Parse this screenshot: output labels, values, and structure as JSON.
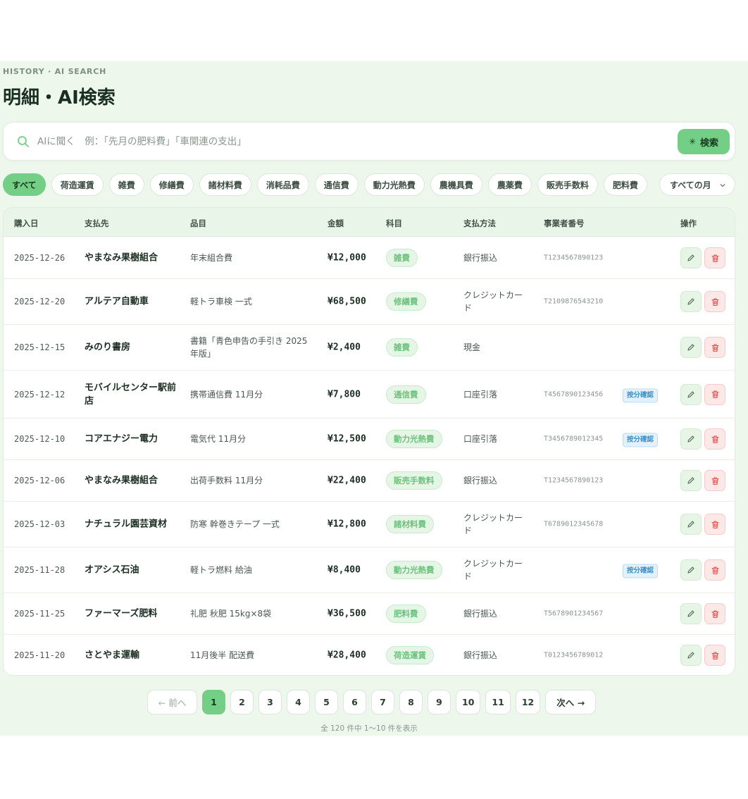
{
  "header": {
    "eyebrow": "HISTORY · AI SEARCH",
    "title": "明細・AI検索"
  },
  "search": {
    "placeholder": "AIに聞く　例：「先月の肥料費」「車関連の支出」",
    "button_label": "検索",
    "button_icon": "sparkle-icon"
  },
  "filters": {
    "chips": [
      "すべて",
      "荷造運賃",
      "雑費",
      "修繕費",
      "諸材料費",
      "消耗品費",
      "通信費",
      "動力光熱費",
      "農機具費",
      "農薬費",
      "販売手数料",
      "肥料費"
    ],
    "active_index": 0,
    "month_select": "すべての月"
  },
  "table": {
    "headers": {
      "date": "購入日",
      "payee": "支払先",
      "item": "品目",
      "amount": "金額",
      "category": "科目",
      "method": "支払方法",
      "registration": "事業者番号",
      "actions": "操作"
    },
    "rows": [
      {
        "date": "2025-12-26",
        "payee": "やまなみ果樹組合",
        "item": "年末組合費",
        "amount": "¥12,000",
        "category": "雑費",
        "method": "銀行振込",
        "registration": "T1234567890123",
        "flag": ""
      },
      {
        "date": "2025-12-20",
        "payee": "アルテア自動車",
        "item": "軽トラ車検 一式",
        "amount": "¥68,500",
        "category": "修繕費",
        "method": "クレジットカード",
        "registration": "T2109876543210",
        "flag": ""
      },
      {
        "date": "2025-12-15",
        "payee": "みのり書房",
        "item": "書籍「青色申告の手引き 2025年版」",
        "amount": "¥2,400",
        "category": "雑費",
        "method": "現金",
        "registration": "",
        "flag": ""
      },
      {
        "date": "2025-12-12",
        "payee": "モバイルセンター駅前店",
        "item": "携帯通信費 11月分",
        "amount": "¥7,800",
        "category": "通信費",
        "method": "口座引落",
        "registration": "T4567890123456",
        "flag": "按分確認"
      },
      {
        "date": "2025-12-10",
        "payee": "コアエナジー電力",
        "item": "電気代 11月分",
        "amount": "¥12,500",
        "category": "動力光熱費",
        "method": "口座引落",
        "registration": "T3456789012345",
        "flag": "按分確認"
      },
      {
        "date": "2025-12-06",
        "payee": "やまなみ果樹組合",
        "item": "出荷手数料 11月分",
        "amount": "¥22,400",
        "category": "販売手数料",
        "method": "銀行振込",
        "registration": "T1234567890123",
        "flag": ""
      },
      {
        "date": "2025-12-03",
        "payee": "ナチュラル園芸資材",
        "item": "防寒 幹巻きテープ 一式",
        "amount": "¥12,800",
        "category": "諸材料費",
        "method": "クレジットカード",
        "registration": "T6789012345678",
        "flag": ""
      },
      {
        "date": "2025-11-28",
        "payee": "オアシス石油",
        "item": "軽トラ燃料 給油",
        "amount": "¥8,400",
        "category": "動力光熱費",
        "method": "クレジットカード",
        "registration": "",
        "flag": "按分確認"
      },
      {
        "date": "2025-11-25",
        "payee": "ファーマーズ肥料",
        "item": "礼肥 秋肥 15kg×8袋",
        "amount": "¥36,500",
        "category": "肥料費",
        "method": "銀行振込",
        "registration": "T5678901234567",
        "flag": ""
      },
      {
        "date": "2025-11-20",
        "payee": "さとやま運輸",
        "item": "11月後半 配送費",
        "amount": "¥28,400",
        "category": "荷造運賃",
        "method": "銀行振込",
        "registration": "T0123456789012",
        "flag": ""
      }
    ]
  },
  "pagination": {
    "prev_label": "← 前へ",
    "next_label": "次へ →",
    "pages": [
      "1",
      "2",
      "3",
      "4",
      "5",
      "6",
      "7",
      "8",
      "9",
      "10",
      "11",
      "12"
    ],
    "current": "1",
    "summary": "全 120 件中 1〜10 件を表示"
  },
  "colors": {
    "accent": "#74cf86",
    "background": "#eef7ec",
    "category_text": "#6cc27c",
    "flag_text": "#3d8fc6",
    "delete": "#e05252"
  }
}
